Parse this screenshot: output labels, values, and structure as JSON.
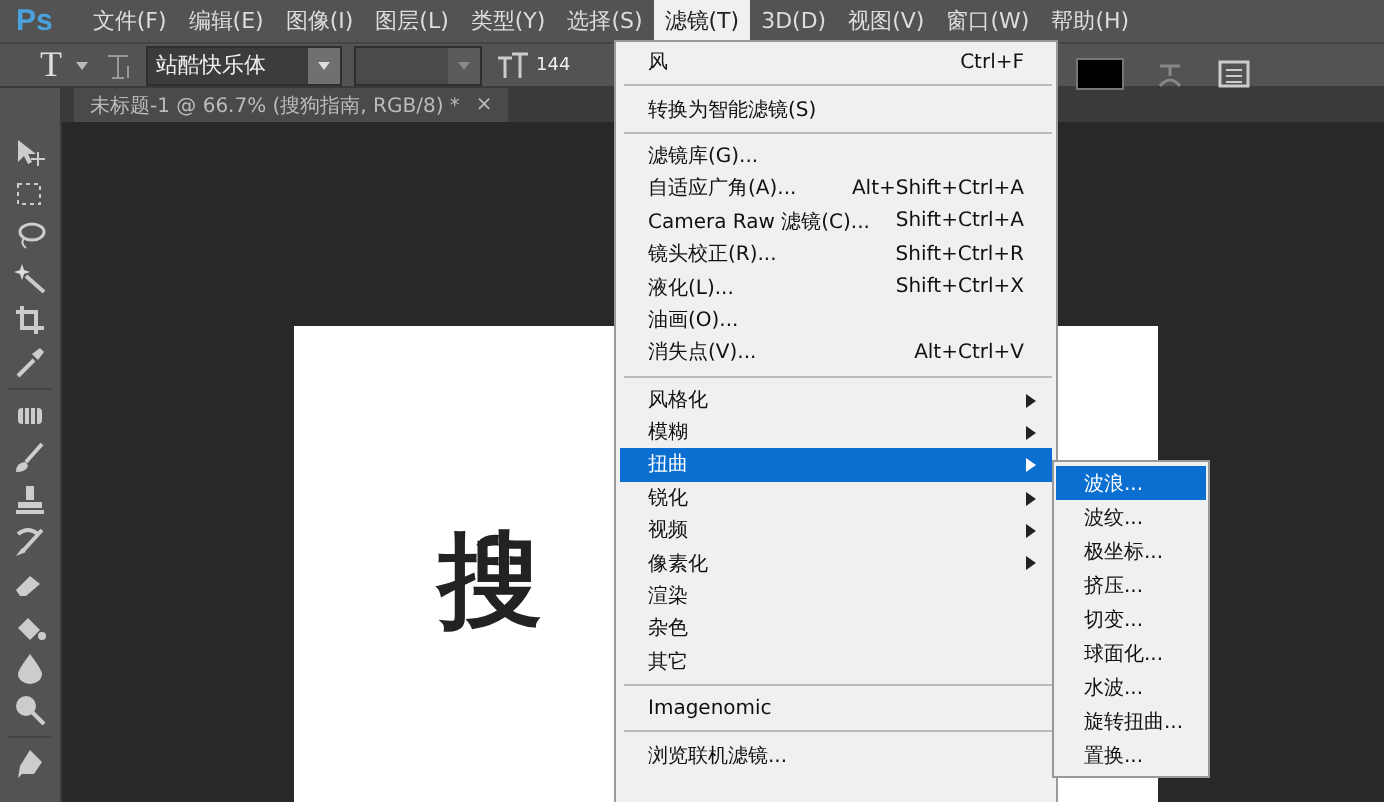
{
  "menubar": {
    "logo": "Ps",
    "items": [
      {
        "label": "文件(F)",
        "selected": false
      },
      {
        "label": "编辑(E)",
        "selected": false
      },
      {
        "label": "图像(I)",
        "selected": false
      },
      {
        "label": "图层(L)",
        "selected": false
      },
      {
        "label": "类型(Y)",
        "selected": false
      },
      {
        "label": "选择(S)",
        "selected": false
      },
      {
        "label": "滤镜(T)",
        "selected": true
      },
      {
        "label": "3D(D)",
        "selected": false
      },
      {
        "label": "视图(V)",
        "selected": false
      },
      {
        "label": "窗口(W)",
        "selected": false
      },
      {
        "label": "帮助(H)",
        "selected": false
      }
    ]
  },
  "options_bar": {
    "tool_letter": "T",
    "font": "站酷快乐体",
    "size": "144"
  },
  "document_tab": {
    "title": "未标题-1 @ 66.7% (搜狗指南, RGB/8) *",
    "close": "×"
  },
  "canvas": {
    "text": "搜"
  },
  "filter_menu": {
    "items": [
      {
        "kind": "item",
        "label": "风",
        "shortcut": "Ctrl+F",
        "selected": false
      },
      {
        "kind": "separator"
      },
      {
        "kind": "item",
        "label": "转换为智能滤镜(S)",
        "selected": false
      },
      {
        "kind": "separator"
      },
      {
        "kind": "item",
        "label": "滤镜库(G)...",
        "selected": false
      },
      {
        "kind": "item",
        "label": "自适应广角(A)...",
        "shortcut": "Alt+Shift+Ctrl+A",
        "selected": false
      },
      {
        "kind": "item",
        "label": "Camera Raw 滤镜(C)...",
        "shortcut": "Shift+Ctrl+A",
        "selected": false
      },
      {
        "kind": "item",
        "label": "镜头校正(R)...",
        "shortcut": "Shift+Ctrl+R",
        "selected": false
      },
      {
        "kind": "item",
        "label": "液化(L)...",
        "shortcut": "Shift+Ctrl+X",
        "selected": false
      },
      {
        "kind": "item",
        "label": "油画(O)...",
        "selected": false
      },
      {
        "kind": "item",
        "label": "消失点(V)...",
        "shortcut": "Alt+Ctrl+V",
        "selected": false
      },
      {
        "kind": "separator"
      },
      {
        "kind": "submenu",
        "label": "风格化",
        "selected": false
      },
      {
        "kind": "submenu",
        "label": "模糊",
        "selected": false
      },
      {
        "kind": "submenu",
        "label": "扭曲",
        "selected": true
      },
      {
        "kind": "submenu",
        "label": "锐化",
        "selected": false
      },
      {
        "kind": "submenu",
        "label": "视频",
        "selected": false
      },
      {
        "kind": "submenu",
        "label": "像素化",
        "selected": false
      },
      {
        "kind": "item",
        "label": "渲染",
        "selected": false
      },
      {
        "kind": "item",
        "label": "杂色",
        "selected": false
      },
      {
        "kind": "item",
        "label": "其它",
        "selected": false
      },
      {
        "kind": "separator"
      },
      {
        "kind": "item",
        "label": "Imagenomic",
        "selected": false
      },
      {
        "kind": "separator"
      },
      {
        "kind": "item",
        "label": "浏览联机滤镜...",
        "selected": false
      }
    ]
  },
  "distort_submenu": {
    "items": [
      {
        "label": "波浪...",
        "selected": true
      },
      {
        "label": "波纹...",
        "selected": false
      },
      {
        "label": "极坐标...",
        "selected": false
      },
      {
        "label": "挤压...",
        "selected": false
      },
      {
        "label": "切变...",
        "selected": false
      },
      {
        "label": "球面化...",
        "selected": false
      },
      {
        "label": "水波...",
        "selected": false
      },
      {
        "label": "旋转扭曲...",
        "selected": false
      },
      {
        "label": "置换...",
        "selected": false
      }
    ]
  }
}
